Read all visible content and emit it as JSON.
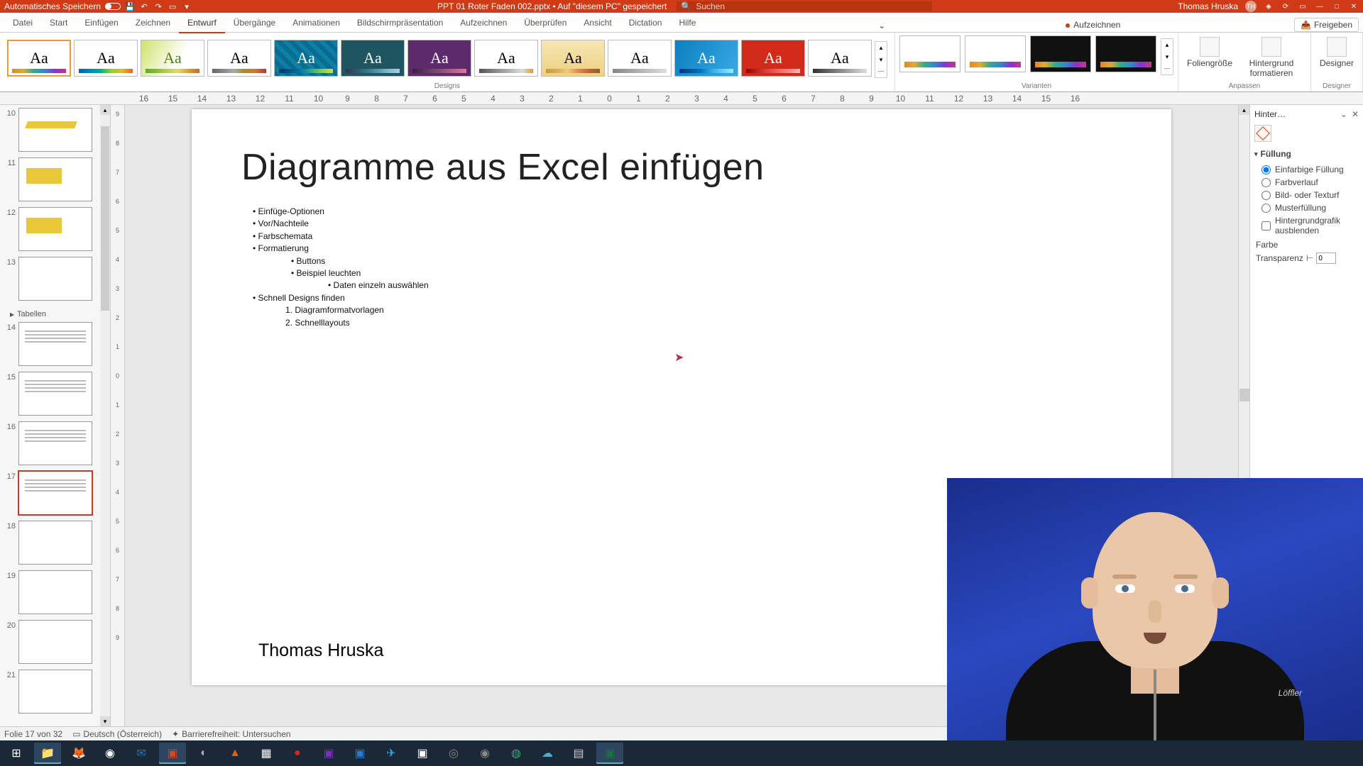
{
  "titlebar": {
    "autosave": "Automatisches Speichern",
    "filename": "PPT 01 Roter Faden 002.pptx  •  Auf \"diesem PC\" gespeichert",
    "search_placeholder": "Suchen",
    "username": "Thomas Hruska",
    "user_initials": "TH"
  },
  "tabs": {
    "file": "Datei",
    "start": "Start",
    "insert": "Einfügen",
    "draw": "Zeichnen",
    "design": "Entwurf",
    "transitions": "Übergänge",
    "animations": "Animationen",
    "slideshow": "Bildschirmpräsentation",
    "record_tab": "Aufzeichnen",
    "review": "Überprüfen",
    "view": "Ansicht",
    "dictation": "Dictation",
    "help": "Hilfe",
    "record": "Aufzeichnen",
    "share": "Freigeben"
  },
  "ribbon": {
    "designs_label": "Designs",
    "variants_label": "Varianten",
    "customize_label": "Anpassen",
    "designer_label": "Designer",
    "slide_size": "Foliengröße",
    "format_bg": "Hintergrund formatieren",
    "designer": "Designer"
  },
  "ruler_h": [
    "16",
    "15",
    "14",
    "13",
    "12",
    "11",
    "10",
    "9",
    "8",
    "7",
    "6",
    "5",
    "4",
    "3",
    "2",
    "1",
    "0",
    "1",
    "2",
    "3",
    "4",
    "5",
    "6",
    "7",
    "8",
    "9",
    "10",
    "11",
    "12",
    "13",
    "14",
    "15",
    "16"
  ],
  "ruler_v": [
    "9",
    "8",
    "7",
    "6",
    "5",
    "4",
    "3",
    "2",
    "1",
    "0",
    "1",
    "2",
    "3",
    "4",
    "5",
    "6",
    "7",
    "8",
    "9"
  ],
  "thumbs": {
    "section": "Tabellen",
    "items": [
      "10",
      "11",
      "12",
      "13",
      "14",
      "15",
      "16",
      "17",
      "18",
      "19",
      "20",
      "21"
    ]
  },
  "slide": {
    "title": "Diagramme aus Excel einfügen",
    "bullets": [
      {
        "lvl": 1,
        "t": "Einfüge-Optionen"
      },
      {
        "lvl": 1,
        "t": "Vor/Nachteile"
      },
      {
        "lvl": 1,
        "t": "Farbschemata"
      },
      {
        "lvl": 1,
        "t": "Formatierung"
      },
      {
        "lvl": 2,
        "t": "Buttons"
      },
      {
        "lvl": 2,
        "t": "Beispiel leuchten"
      },
      {
        "lvl": 3,
        "t": "Daten einzeln auswählen"
      },
      {
        "lvl": 1,
        "t": "Schnell Designs finden"
      }
    ],
    "numbered": [
      {
        "n": "1.",
        "t": "Diagramformatvorlagen"
      },
      {
        "n": "2.",
        "t": "Schnelllayouts"
      }
    ],
    "author": "Thomas Hruska"
  },
  "format_pane": {
    "title": "Hinter…",
    "fill_section": "Füllung",
    "opts": {
      "solid": "Einfarbige Füllung",
      "gradient": "Farbverlauf",
      "picture": "Bild- oder Texturf",
      "pattern": "Musterfüllung",
      "hide": "Hintergrundgrafik ausblenden"
    },
    "color": "Farbe",
    "transparency": "Transparenz",
    "transparency_value": "0"
  },
  "status": {
    "slide_info": "Folie 17 von 32",
    "language": "Deutsch (Österreich)",
    "accessibility": "Barrierefreiheit: Untersuchen"
  }
}
